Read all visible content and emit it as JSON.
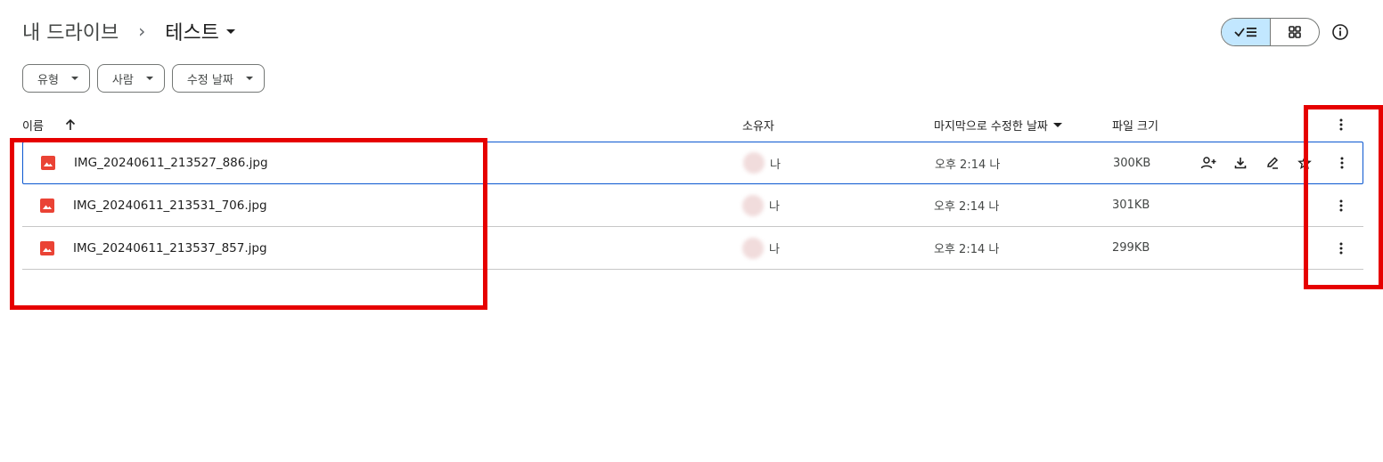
{
  "breadcrumb": {
    "root": "내 드라이브",
    "separator": "›",
    "current": "테스트"
  },
  "view": {
    "mode": "list",
    "list_icon": "check-list-icon",
    "grid_icon": "grid-icon",
    "info_icon": "info-icon"
  },
  "filters": [
    {
      "label": "유형"
    },
    {
      "label": "사람"
    },
    {
      "label": "수정 날짜"
    }
  ],
  "table": {
    "columns": {
      "name": "이름",
      "owner": "소유자",
      "modified": "마지막으로 수정한 날짜",
      "size": "파일 크기"
    },
    "rows": [
      {
        "name": "IMG_20240611_213527_886.jpg",
        "owner": "나",
        "modified": "오후 2:14 나",
        "size": "300KB",
        "selected": true
      },
      {
        "name": "IMG_20240611_213531_706.jpg",
        "owner": "나",
        "modified": "오후 2:14 나",
        "size": "301KB",
        "selected": false
      },
      {
        "name": "IMG_20240611_213537_857.jpg",
        "owner": "나",
        "modified": "오후 2:14 나",
        "size": "299KB",
        "selected": false
      }
    ]
  },
  "colors": {
    "accent": "#0b57d0",
    "toggle_active": "#c2e7ff",
    "image_icon": "#ea4335",
    "highlight": "#e60000"
  }
}
